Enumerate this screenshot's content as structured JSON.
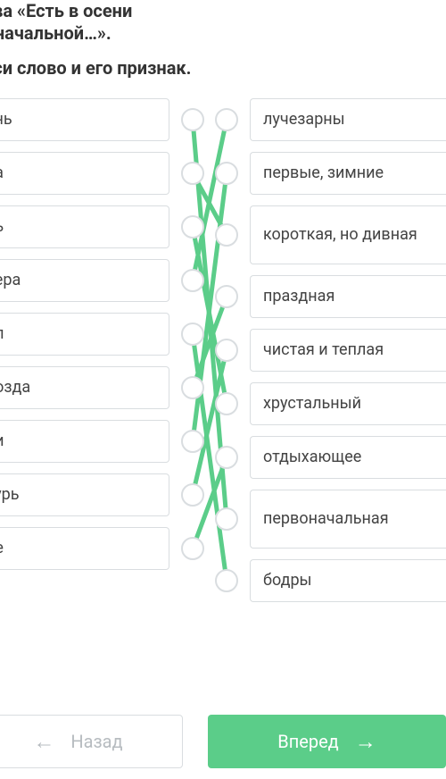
{
  "header": {
    "title_line1": "тчева «Есть в осени",
    "title_line2": "рвоначальной…».",
    "subtitle": "тнеси слово и его признак."
  },
  "left_items": [
    "ень",
    "ра",
    "нь",
    "чера",
    "рп",
    "розда",
    "ри",
    "зурь",
    "ле"
  ],
  "right_items": [
    "лучезарны",
    "первые, зимние",
    "короткая, но дивная",
    "праздная",
    "чистая и теплая",
    "хрустальный",
    "отдыхающее",
    "первоначальная",
    "бодры"
  ],
  "connections": [
    [
      0,
      7
    ],
    [
      1,
      2
    ],
    [
      2,
      5
    ],
    [
      3,
      0
    ],
    [
      4,
      8
    ],
    [
      5,
      3
    ],
    [
      6,
      1
    ],
    [
      7,
      4
    ],
    [
      8,
      6
    ]
  ],
  "footer": {
    "back_label": "Назад",
    "fwd_label": "Вперед"
  },
  "colors": {
    "line": "#5bcd89",
    "border": "#d9dde0"
  },
  "icons": {
    "arrow_left": "←",
    "arrow_right": "→"
  }
}
